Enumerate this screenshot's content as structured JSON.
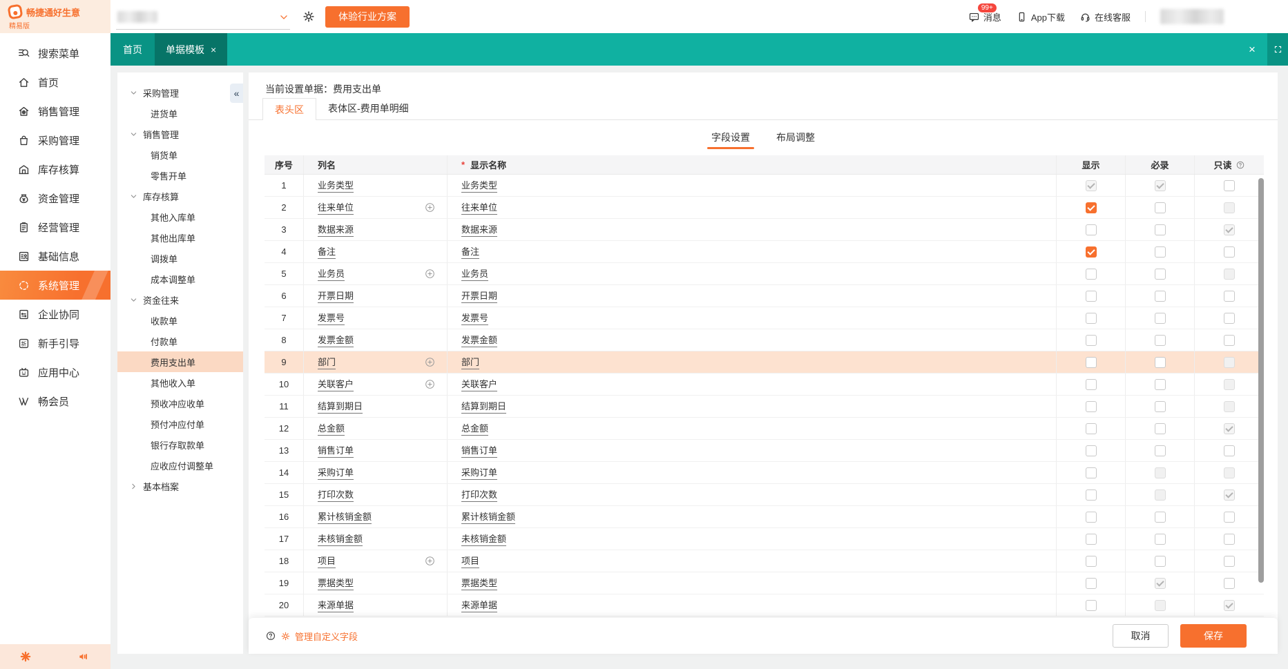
{
  "colors": {
    "accent": "#f7702e",
    "teal_bar": "#10b1a1",
    "tree_selected_bg": "#fbd9c3",
    "row_highlight_bg": "#fde2d0"
  },
  "brand": {
    "name": "畅捷通好生意",
    "edition": "精易版"
  },
  "topbar": {
    "try_button": "体验行业方案",
    "messages_label": "消息",
    "messages_badge": "99+",
    "app_download_label": "App下载",
    "support_label": "在线客服"
  },
  "tabbar": {
    "home_tab": "首页",
    "active_tab": "单据模板"
  },
  "sidebar": {
    "items": [
      {
        "id": "search",
        "label": "搜索菜单",
        "icon": "search-icon",
        "active": false
      },
      {
        "id": "home",
        "label": "首页",
        "icon": "home-icon",
        "active": false
      },
      {
        "id": "sales",
        "label": "销售管理",
        "icon": "sales-shop-icon",
        "active": false
      },
      {
        "id": "purchase",
        "label": "采购管理",
        "icon": "purchase-bag-icon",
        "active": false
      },
      {
        "id": "inventory",
        "label": "库存核算",
        "icon": "warehouse-icon",
        "active": false
      },
      {
        "id": "funds",
        "label": "资金管理",
        "icon": "money-bag-icon",
        "active": false
      },
      {
        "id": "business",
        "label": "经营管理",
        "icon": "clipboard-icon",
        "active": false
      },
      {
        "id": "basicinfo",
        "label": "基础信息",
        "icon": "document-list-icon",
        "active": false
      },
      {
        "id": "system",
        "label": "系统管理",
        "icon": "sync-circle-icon",
        "active": true
      },
      {
        "id": "collab",
        "label": "企业协同",
        "icon": "exchange-doc-icon",
        "active": false
      },
      {
        "id": "guide",
        "label": "新手引导",
        "icon": "new-badge-icon",
        "active": false
      },
      {
        "id": "appcenter",
        "label": "应用中心",
        "icon": "tv-smile-icon",
        "active": false
      },
      {
        "id": "member",
        "label": "畅会员",
        "icon": "vip-icon",
        "active": false
      }
    ]
  },
  "tree": {
    "selected": "费用支出单",
    "groups": [
      {
        "label": "采购管理",
        "expanded": true,
        "children": [
          "进货单"
        ]
      },
      {
        "label": "销售管理",
        "expanded": true,
        "children": [
          "销货单",
          "零售开单"
        ]
      },
      {
        "label": "库存核算",
        "expanded": true,
        "children": [
          "其他入库单",
          "其他出库单",
          "调拨单",
          "成本调整单"
        ]
      },
      {
        "label": "资金往来",
        "expanded": true,
        "children": [
          "收款单",
          "付款单",
          "费用支出单",
          "其他收入单",
          "预收冲应收单",
          "预付冲应付单",
          "银行存取款单",
          "应收应付调整单"
        ]
      },
      {
        "label": "基本档案",
        "expanded": false,
        "children": []
      }
    ]
  },
  "content": {
    "current_doc_label": "当前设置单据：费用支出单",
    "region_tabs": [
      {
        "label": "表头区",
        "active": true
      },
      {
        "label": "表体区-费用单明细",
        "active": false
      }
    ],
    "setting_tabs": [
      {
        "label": "字段设置",
        "active": true
      },
      {
        "label": "布局调整",
        "active": false
      }
    ],
    "table": {
      "headers": {
        "seq": "序号",
        "name": "列名",
        "display": "显示名称",
        "show": "显示",
        "required": "必录",
        "readonly": "只读"
      },
      "rows": [
        {
          "seq": 1,
          "name": "业务类型",
          "display": "业务类型",
          "plus": false,
          "highlight": false,
          "show": "checked-disabled",
          "required": "checked-disabled",
          "readonly": "unchecked"
        },
        {
          "seq": 2,
          "name": "往来单位",
          "display": "往来单位",
          "plus": true,
          "highlight": false,
          "show": "checked",
          "required": "unchecked",
          "readonly": "disabled"
        },
        {
          "seq": 3,
          "name": "数据来源",
          "display": "数据来源",
          "plus": false,
          "highlight": false,
          "show": "unchecked",
          "required": "unchecked",
          "readonly": "checked-disabled"
        },
        {
          "seq": 4,
          "name": "备注",
          "display": "备注",
          "plus": false,
          "highlight": false,
          "show": "checked",
          "required": "unchecked",
          "readonly": "unchecked"
        },
        {
          "seq": 5,
          "name": "业务员",
          "display": "业务员",
          "plus": true,
          "highlight": false,
          "show": "unchecked",
          "required": "unchecked",
          "readonly": "disabled"
        },
        {
          "seq": 6,
          "name": "开票日期",
          "display": "开票日期",
          "plus": false,
          "highlight": false,
          "show": "unchecked",
          "required": "unchecked",
          "readonly": "unchecked"
        },
        {
          "seq": 7,
          "name": "发票号",
          "display": "发票号",
          "plus": false,
          "highlight": false,
          "show": "unchecked",
          "required": "unchecked",
          "readonly": "unchecked"
        },
        {
          "seq": 8,
          "name": "发票金额",
          "display": "发票金额",
          "plus": false,
          "highlight": false,
          "show": "unchecked",
          "required": "unchecked",
          "readonly": "unchecked"
        },
        {
          "seq": 9,
          "name": "部门",
          "display": "部门",
          "plus": true,
          "highlight": true,
          "show": "unchecked",
          "required": "unchecked",
          "readonly": "disabled"
        },
        {
          "seq": 10,
          "name": "关联客户",
          "display": "关联客户",
          "plus": true,
          "highlight": false,
          "show": "unchecked",
          "required": "unchecked",
          "readonly": "disabled"
        },
        {
          "seq": 11,
          "name": "结算到期日",
          "display": "结算到期日",
          "plus": false,
          "highlight": false,
          "show": "unchecked",
          "required": "unchecked",
          "readonly": "disabled"
        },
        {
          "seq": 12,
          "name": "总金额",
          "display": "总金额",
          "plus": false,
          "highlight": false,
          "show": "unchecked",
          "required": "unchecked",
          "readonly": "checked-disabled"
        },
        {
          "seq": 13,
          "name": "销售订单",
          "display": "销售订单",
          "plus": false,
          "highlight": false,
          "show": "unchecked",
          "required": "unchecked",
          "readonly": "unchecked"
        },
        {
          "seq": 14,
          "name": "采购订单",
          "display": "采购订单",
          "plus": false,
          "highlight": false,
          "show": "unchecked",
          "required": "disabled",
          "readonly": "disabled"
        },
        {
          "seq": 15,
          "name": "打印次数",
          "display": "打印次数",
          "plus": false,
          "highlight": false,
          "show": "unchecked",
          "required": "disabled",
          "readonly": "checked-disabled"
        },
        {
          "seq": 16,
          "name": "累计核销金额",
          "display": "累计核销金额",
          "plus": false,
          "highlight": false,
          "show": "unchecked",
          "required": "unchecked",
          "readonly": "unchecked"
        },
        {
          "seq": 17,
          "name": "未核销金额",
          "display": "未核销金额",
          "plus": false,
          "highlight": false,
          "show": "unchecked",
          "required": "unchecked",
          "readonly": "unchecked"
        },
        {
          "seq": 18,
          "name": "项目",
          "display": "项目",
          "plus": true,
          "highlight": false,
          "show": "unchecked",
          "required": "unchecked",
          "readonly": "unchecked"
        },
        {
          "seq": 19,
          "name": "票据类型",
          "display": "票据类型",
          "plus": false,
          "highlight": false,
          "show": "unchecked",
          "required": "checked-disabled",
          "readonly": "unchecked"
        },
        {
          "seq": 20,
          "name": "来源单据",
          "display": "来源单据",
          "plus": false,
          "highlight": false,
          "show": "unchecked",
          "required": "disabled",
          "readonly": "checked-disabled"
        }
      ]
    },
    "manage_custom_fields_label": "管理自定义字段",
    "cancel_label": "取消",
    "save_label": "保存"
  }
}
